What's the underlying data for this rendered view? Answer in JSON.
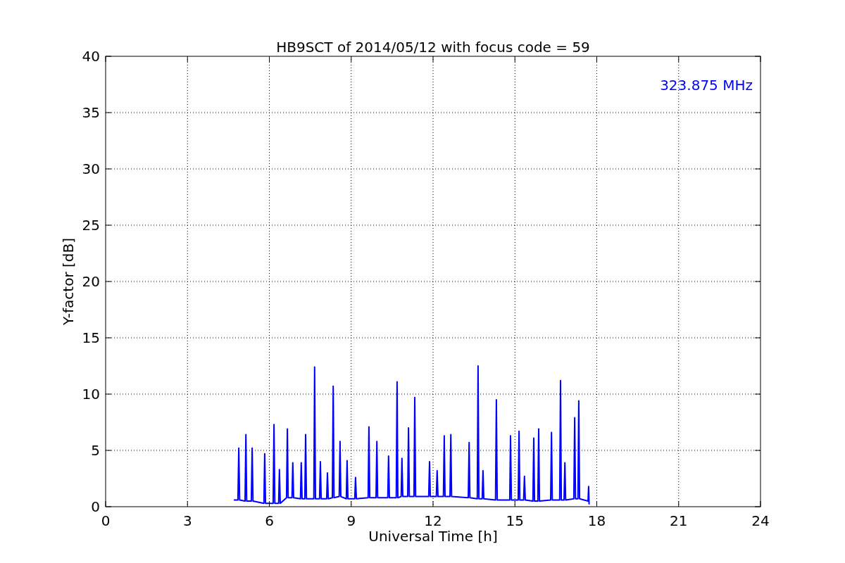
{
  "chart_data": {
    "type": "line",
    "title": "HB9SCT of 2014/05/12 with focus code = 59",
    "xlabel": "Universal Time [h]",
    "ylabel": "Y-factor [dB]",
    "x": [
      4.7,
      4.85,
      4.88,
      4.91,
      5.11,
      5.14,
      5.17,
      5.34,
      5.37,
      5.4,
      5.8,
      5.83,
      5.86,
      6.14,
      6.17,
      6.2,
      6.34,
      6.37,
      6.4,
      6.63,
      6.66,
      6.69,
      6.83,
      6.86,
      6.89,
      7.14,
      7.17,
      7.2,
      7.3,
      7.33,
      7.36,
      7.63,
      7.66,
      7.69,
      7.84,
      7.87,
      7.9,
      8.1,
      8.13,
      8.16,
      8.31,
      8.34,
      8.37,
      8.56,
      8.59,
      8.62,
      8.82,
      8.85,
      8.88,
      9.13,
      9.16,
      9.19,
      9.62,
      9.65,
      9.68,
      9.91,
      9.94,
      9.97,
      10.34,
      10.37,
      10.4,
      10.65,
      10.68,
      10.71,
      10.83,
      10.86,
      10.89,
      11.07,
      11.1,
      11.13,
      11.3,
      11.33,
      11.36,
      11.84,
      11.87,
      11.9,
      12.12,
      12.15,
      12.18,
      12.38,
      12.41,
      12.44,
      12.62,
      12.65,
      12.68,
      13.29,
      13.32,
      13.35,
      13.62,
      13.65,
      13.68,
      13.8,
      13.83,
      13.86,
      14.29,
      14.32,
      14.35,
      14.81,
      14.84,
      14.87,
      15.12,
      15.15,
      15.18,
      15.32,
      15.35,
      15.38,
      15.66,
      15.69,
      15.72,
      15.84,
      15.87,
      15.9,
      16.31,
      16.34,
      16.37,
      16.64,
      16.67,
      16.7,
      16.8,
      16.83,
      16.86,
      17.16,
      17.19,
      17.22,
      17.31,
      17.34,
      17.37,
      17.68,
      17.7,
      17.72
    ],
    "series": [
      {
        "color": "#0000ff",
        "values": [
          0.6,
          0.6,
          5.2,
          0.6,
          0.5,
          6.4,
          0.5,
          0.5,
          5.2,
          0.5,
          0.3,
          4.7,
          0.3,
          0.3,
          7.3,
          0.3,
          0.3,
          3.3,
          0.3,
          0.8,
          6.9,
          0.8,
          0.8,
          3.9,
          0.8,
          0.7,
          3.9,
          0.7,
          0.7,
          6.4,
          0.7,
          0.7,
          12.4,
          0.7,
          0.7,
          4.0,
          0.7,
          0.7,
          3.0,
          0.7,
          0.8,
          10.7,
          0.8,
          0.9,
          5.8,
          0.9,
          0.7,
          4.1,
          0.7,
          0.7,
          2.6,
          0.7,
          0.8,
          7.1,
          0.8,
          0.8,
          5.8,
          0.8,
          0.8,
          4.5,
          0.8,
          0.8,
          11.1,
          0.8,
          0.9,
          4.3,
          0.9,
          0.9,
          7.0,
          0.9,
          0.9,
          9.7,
          0.9,
          0.9,
          4.0,
          0.9,
          0.9,
          3.2,
          0.9,
          0.9,
          6.3,
          0.9,
          0.9,
          6.4,
          0.9,
          0.8,
          5.7,
          0.8,
          0.7,
          12.5,
          0.7,
          0.7,
          3.2,
          0.7,
          0.6,
          9.5,
          0.6,
          0.6,
          6.3,
          0.6,
          0.6,
          6.7,
          0.6,
          0.6,
          2.7,
          0.6,
          0.5,
          6.1,
          0.5,
          0.5,
          6.9,
          0.5,
          0.6,
          6.6,
          0.6,
          0.6,
          11.2,
          0.6,
          0.6,
          3.9,
          0.6,
          0.7,
          7.9,
          0.7,
          0.7,
          9.4,
          0.7,
          0.5,
          1.8,
          0.2
        ]
      }
    ],
    "xlim": [
      0,
      24
    ],
    "ylim": [
      0,
      40
    ],
    "xticks": [
      0,
      3,
      6,
      9,
      12,
      15,
      18,
      21,
      24
    ],
    "yticks": [
      0,
      5,
      10,
      15,
      20,
      25,
      30,
      35,
      40
    ],
    "grid": true,
    "annotations": [
      {
        "text": "323.875 MHz"
      }
    ]
  }
}
